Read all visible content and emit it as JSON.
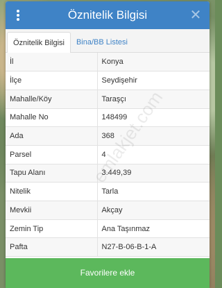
{
  "header": {
    "title": "Öznitelik Bilgisi",
    "close_glyph": "✕"
  },
  "tabs": [
    {
      "label": "Öznitelik Bilgisi",
      "active": true
    },
    {
      "label": "Bina/BB Listesi",
      "active": false
    }
  ],
  "rows": [
    {
      "key": "İl",
      "value": "Konya"
    },
    {
      "key": "İlçe",
      "value": "Seydişehir"
    },
    {
      "key": "Mahalle/Köy",
      "value": "Taraşçı"
    },
    {
      "key": "Mahalle No",
      "value": "148499"
    },
    {
      "key": "Ada",
      "value": "368"
    },
    {
      "key": "Parsel",
      "value": "4"
    },
    {
      "key": "Tapu Alanı",
      "value": "3.449,39"
    },
    {
      "key": "Nitelik",
      "value": "Tarla"
    },
    {
      "key": "Mevkii",
      "value": "Akçay"
    },
    {
      "key": "Zemin Tip",
      "value": "Ana Taşınmaz"
    },
    {
      "key": "Pafta",
      "value": "N27-B-06-B-1-A"
    }
  ],
  "footer": {
    "favorites_label": "Favorilere ekle"
  },
  "watermark": "emlakjet.com",
  "colors": {
    "header": "#3f83c6",
    "button": "#5cb85c",
    "tab_link": "#3f83c6"
  }
}
